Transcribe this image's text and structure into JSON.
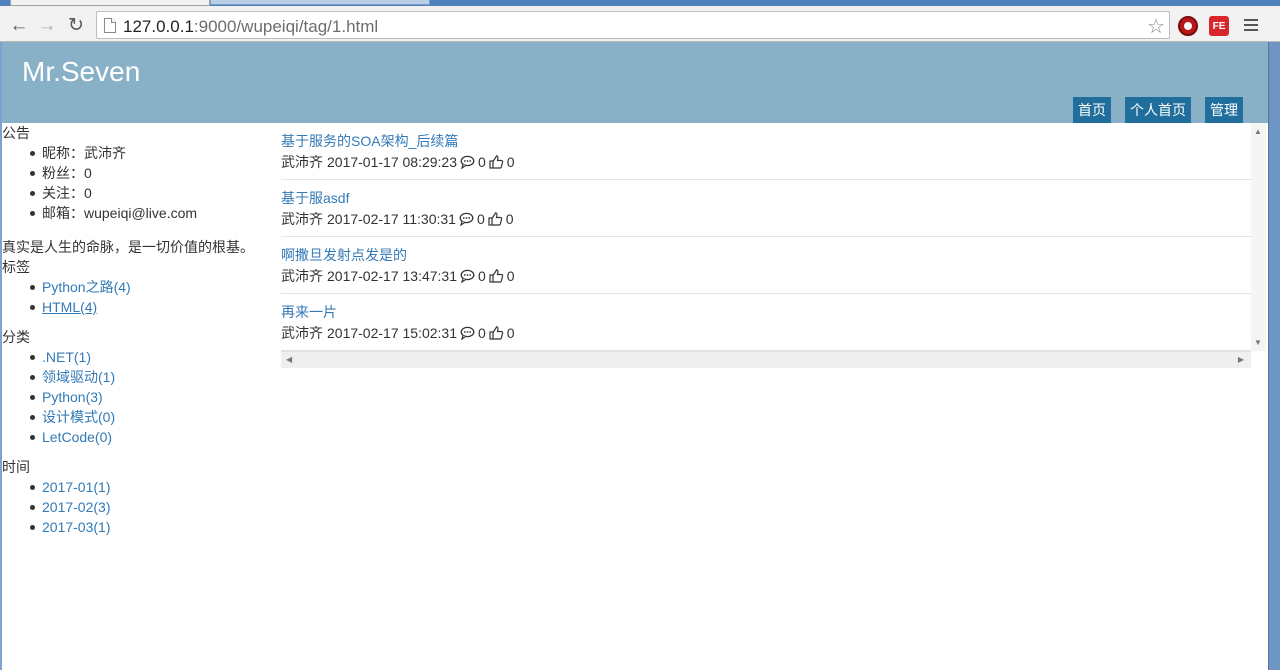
{
  "browser": {
    "url_host": "127.0.0.1",
    "url_rest": ":9000/wupeiqi/tag/1.html",
    "fe_label": "FE"
  },
  "site": {
    "title": "Mr.Seven",
    "nav": [
      "首页",
      "个人首页",
      "管理"
    ]
  },
  "sidebar": {
    "notice_heading": "公告",
    "profile": [
      "昵称：武沛齐",
      "粉丝：0",
      "关注：0",
      "邮箱：wupeiqi@live.com"
    ],
    "motto": "真实是人生的命脉，是一切价值的根基。",
    "tags_heading": "标签",
    "tags": [
      "Python之路(4)",
      "HTML(4)"
    ],
    "categories_heading": "分类",
    "categories": [
      ".NET(1)",
      "领域驱动(1)",
      "Python(3)",
      "设计模式(0)",
      "LetCode(0)"
    ],
    "time_heading": "时间",
    "months": [
      "2017-01(1)",
      "2017-02(3)",
      "2017-03(1)"
    ]
  },
  "articles": [
    {
      "title": "基于服务的SOA架构_后续篇",
      "author": "武沛齐",
      "date": "2017-01-17 08:29:23",
      "comments": "0",
      "likes": "0"
    },
    {
      "title": "基于服asdf",
      "author": "武沛齐",
      "date": "2017-02-17 11:30:31",
      "comments": "0",
      "likes": "0"
    },
    {
      "title": "啊撒旦发射点发是的",
      "author": "武沛齐",
      "date": "2017-02-17 13:47:31",
      "comments": "0",
      "likes": "0"
    },
    {
      "title": "再来一片",
      "author": "武沛齐",
      "date": "2017-02-17 15:02:31",
      "comments": "0",
      "likes": "0"
    }
  ]
}
